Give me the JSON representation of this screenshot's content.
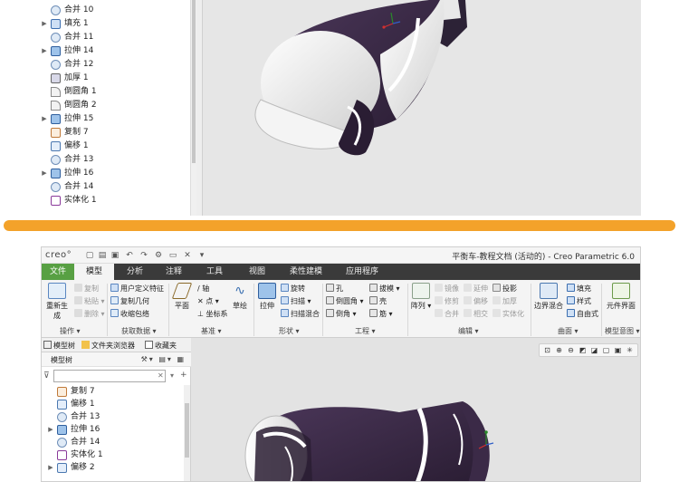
{
  "top_tree": {
    "items": [
      {
        "label": "合并 10",
        "icon": "merge-icon",
        "expandable": false
      },
      {
        "label": "填充 1",
        "icon": "fill-icon",
        "expandable": true
      },
      {
        "label": "合并 11",
        "icon": "merge-icon",
        "expandable": false
      },
      {
        "label": "拉伸 14",
        "icon": "extrude-icon",
        "expandable": true
      },
      {
        "label": "合并 12",
        "icon": "merge-icon",
        "expandable": false
      },
      {
        "label": "加厚 1",
        "icon": "thicken-icon",
        "expandable": false
      },
      {
        "label": "倒圆角 1",
        "icon": "round-icon",
        "expandable": false
      },
      {
        "label": "倒圆角 2",
        "icon": "round-icon",
        "expandable": false
      },
      {
        "label": "拉伸 15",
        "icon": "extrude-icon",
        "expandable": true
      },
      {
        "label": "复制 7",
        "icon": "copy-icon",
        "expandable": false
      },
      {
        "label": "偏移 1",
        "icon": "offset-icon",
        "expandable": false
      },
      {
        "label": "合并 13",
        "icon": "merge-icon",
        "expandable": false
      },
      {
        "label": "拉伸 16",
        "icon": "extrude-icon",
        "expandable": true
      },
      {
        "label": "合并 14",
        "icon": "merge-icon",
        "expandable": false
      },
      {
        "label": "实体化 1",
        "icon": "solidify-icon",
        "expandable": false
      }
    ]
  },
  "window": {
    "logo": "creo°",
    "title": "平衡车-教程文档 (活动的) - Creo Parametric 6.0"
  },
  "ribbon_tabs": [
    "文件",
    "模型",
    "分析",
    "注释",
    "工具",
    "视图",
    "柔性建模",
    "应用程序"
  ],
  "ribbon": {
    "operations": {
      "regenerate": "重新生成",
      "copy": "复制",
      "paste": "粘贴",
      "delete": "删除",
      "group": "操作"
    },
    "get_data": {
      "udf": "用户定义特征",
      "copy_geom": "复制几何",
      "shrinkwrap": "收缩包络",
      "group": "获取数据"
    },
    "datum": {
      "plane": "平面",
      "axis": "轴",
      "point": "点",
      "csys": "坐标系",
      "sketch": "草绘",
      "group": "基准"
    },
    "shapes": {
      "extrude": "拉伸",
      "revolve": "旋转",
      "sweep": "扫描",
      "swept_blend": "扫描混合",
      "group": "形状"
    },
    "engineering": {
      "hole": "孔",
      "round": "倒圆角",
      "chamfer": "倒角",
      "draft": "拔模",
      "shell": "壳",
      "rib": "筋",
      "group": "工程"
    },
    "editing": {
      "pattern": "阵列",
      "mirror": "镜像",
      "extend": "延伸",
      "project": "投影",
      "trim": "修剪",
      "offset": "偏移",
      "thicken": "加厚",
      "merge": "合并",
      "intersect": "相交",
      "solidify": "实体化",
      "group": "编辑"
    },
    "surfaces": {
      "boundary_blend": "边界混合",
      "fill": "填充",
      "style": "样式",
      "freestyle": "自由式",
      "group": "曲面"
    },
    "model_intent": {
      "component_interface": "元件界面",
      "group": "模型意图"
    }
  },
  "tree_tabs": {
    "model_tree": "模型树",
    "file_browser": "文件夹浏览器",
    "favorites": "收藏夹"
  },
  "tree_panel": {
    "header": "模型树",
    "filter_placeholder": "",
    "items": [
      {
        "label": "复制 7",
        "icon": "copy-icon",
        "expandable": false
      },
      {
        "label": "偏移 1",
        "icon": "offset-icon",
        "expandable": false
      },
      {
        "label": "合并 13",
        "icon": "merge-icon",
        "expandable": false
      },
      {
        "label": "拉伸 16",
        "icon": "extrude-icon",
        "expandable": true
      },
      {
        "label": "合并 14",
        "icon": "merge-icon",
        "expandable": false
      },
      {
        "label": "实体化 1",
        "icon": "solidify-icon",
        "expandable": false
      },
      {
        "label": "偏移 2",
        "icon": "offset-icon",
        "expandable": true
      }
    ]
  },
  "colors": {
    "accent_orange": "#f3a22a",
    "file_tab_green": "#58a043",
    "ribbon_dark": "#3a3a3a",
    "model_purple": "#3b2a47"
  }
}
